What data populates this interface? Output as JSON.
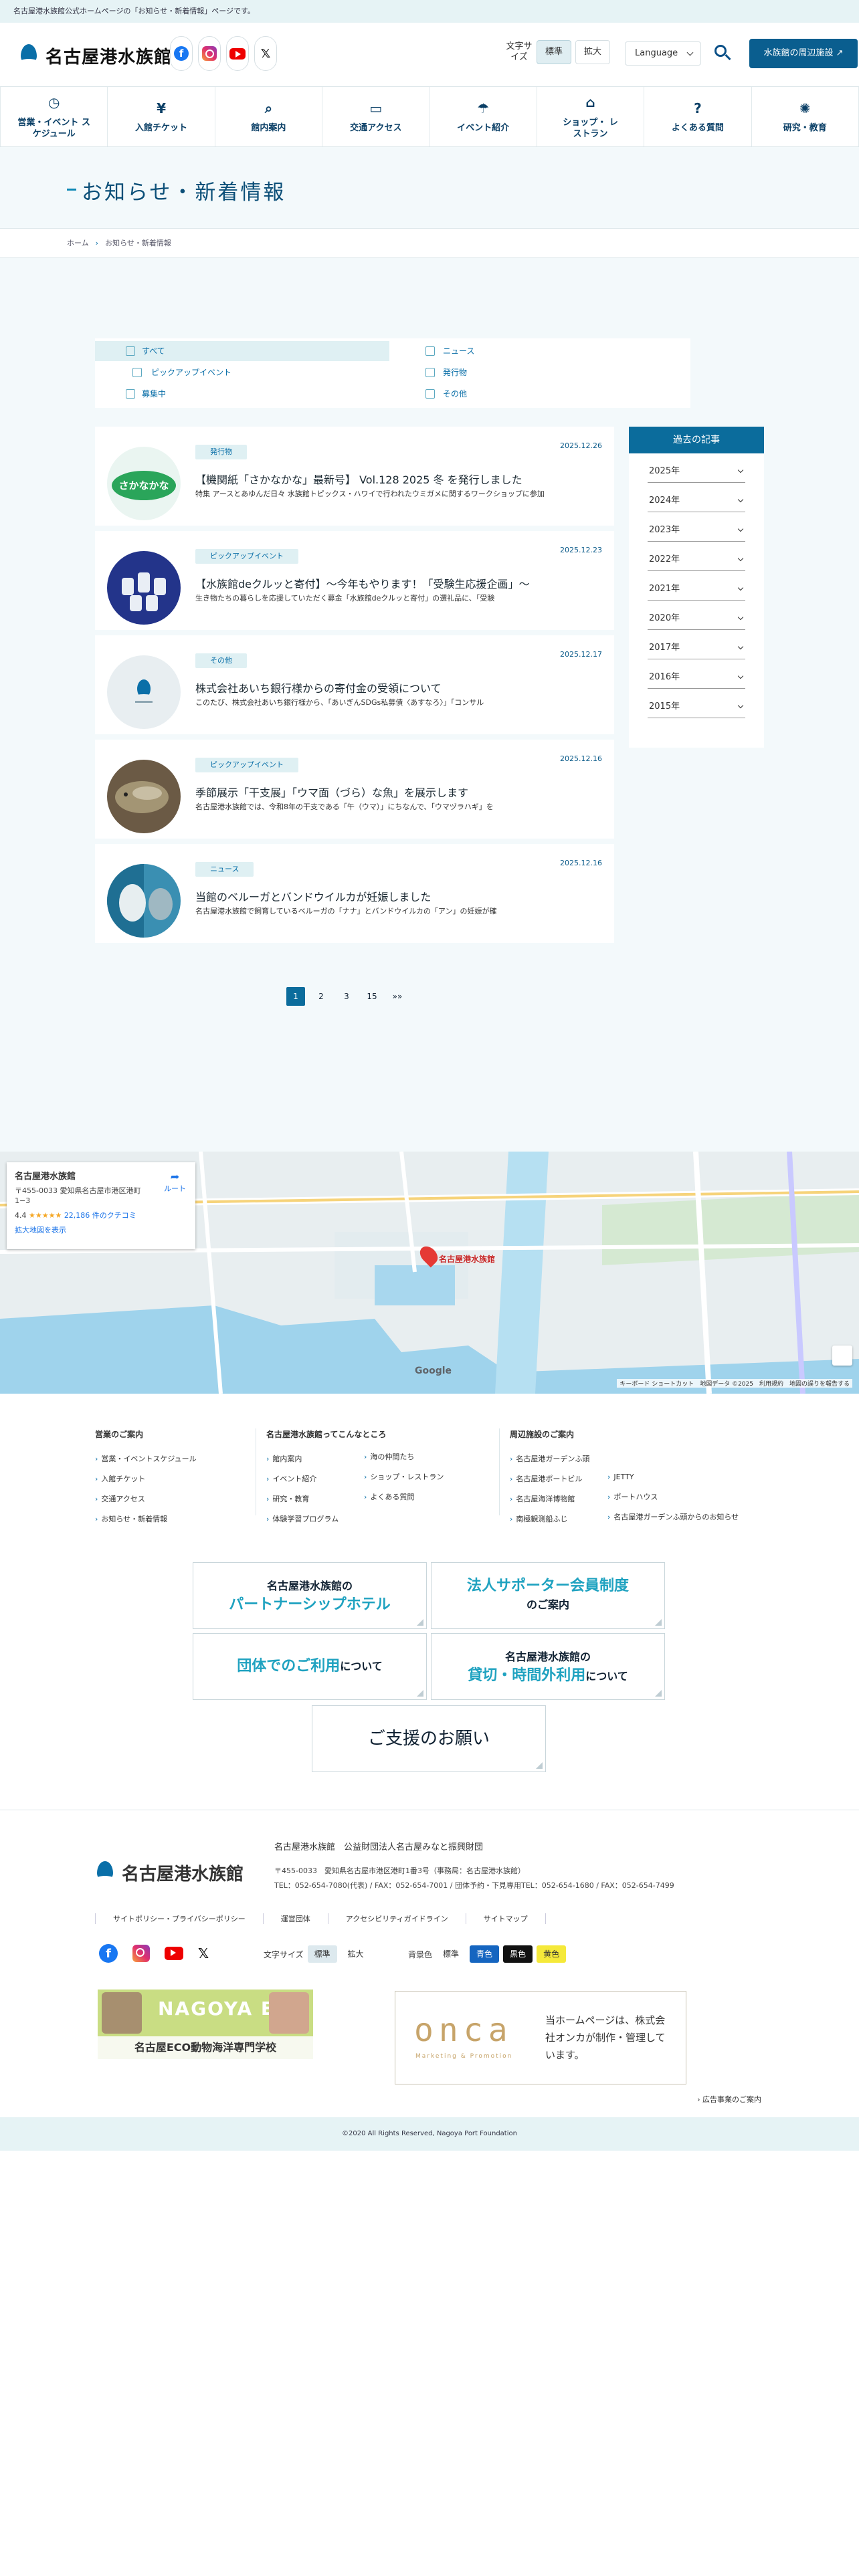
{
  "top_notice": "名古屋港水族館公式ホームページの「お知らせ・新着情報」ページです。",
  "header": {
    "logo_text": "名古屋港水族館",
    "font_size_label": "文字サイズ",
    "font_size_options": [
      "標準",
      "拡大"
    ],
    "language": "Language",
    "nearby_button": "水族館の周辺施設"
  },
  "gnav": [
    {
      "label": "営業・イベント スケジュール",
      "icon": "clock-icon"
    },
    {
      "label": "入館チケット",
      "icon": "yen-icon"
    },
    {
      "label": "館内案内",
      "icon": "map-search-icon"
    },
    {
      "label": "交通アクセス",
      "icon": "bus-icon"
    },
    {
      "label": "イベント紹介",
      "icon": "megaphone-icon"
    },
    {
      "label": "ショップ・ レストラン",
      "icon": "shop-icon"
    },
    {
      "label": "よくある質問",
      "icon": "question-icon"
    },
    {
      "label": "研究・教育",
      "icon": "bulb-icon"
    }
  ],
  "page_title": "お知らせ・新着情報",
  "breadcrumb": [
    "ホーム",
    "お知らせ・新着情報"
  ],
  "filters": [
    {
      "label": "すべて",
      "active": true
    },
    {
      "label": "ニュース",
      "active": false
    },
    {
      "label": "ピックアップイベント",
      "active": false
    },
    {
      "label": "発行物",
      "active": false
    },
    {
      "label": "募集中",
      "active": false
    },
    {
      "label": "その他",
      "active": false
    }
  ],
  "articles": [
    {
      "category": "発行物",
      "date": "2025.12.26",
      "title": "【機関紙「さかなかな」最新号】 Vol.128 2025 冬 を発行しました",
      "desc": "特集 アースとあゆんだ日々 水族館トピックス・ハワイで行われたウミガメに関するワークショップに参加"
    },
    {
      "category": "ピックアップイベント",
      "date": "2025.12.23",
      "title": "【水族館deクルッと寄付】～今年もやります！「受験生応援企画」～",
      "desc": "生き物たちの暮らしを応援していただく募金「水族館deクルッと寄付」の選礼品に、「受験"
    },
    {
      "category": "その他",
      "date": "2025.12.17",
      "title": "株式会社あいち銀行様からの寄付金の受領について",
      "desc": "このたび、株式会社あいち銀行様から、「あいぎんSDGs私募債〈あすなろ〉」「コンサル"
    },
    {
      "category": "ピックアップイベント",
      "date": "2025.12.16",
      "title": "季節展示「干支展」「ウマ面（づら）な魚」を展示します",
      "desc": "名古屋港水族館では、令和8年の干支である「午（ウマ）」にちなんで、「ウマヅラハギ」を"
    },
    {
      "category": "ニュース",
      "date": "2025.12.16",
      "title": "当館のベルーガとバンドウイルカが妊娠しました",
      "desc": "名古屋港水族館で飼育しているベルーガの「ナナ」とバンドウイルカの「アン」の妊娠が確"
    }
  ],
  "archive": {
    "heading": "過去の記事",
    "years": [
      "2025年",
      "2024年",
      "2023年",
      "2022年",
      "2021年",
      "2020年",
      "2017年",
      "2016年",
      "2015年"
    ]
  },
  "pager": [
    "1",
    "2",
    "3",
    "15",
    "»»"
  ],
  "map": {
    "place": "名古屋港水族館",
    "address": "〒455-0033 愛知県名古屋市港区港町 1−3",
    "rating": "4.4",
    "stars": "★★★★★",
    "reviews": "22,186 件のクチコミ",
    "route": "ルート",
    "enlarge": "拡大地図を表示",
    "pin_label": "名古屋港水族館",
    "attribution": "キーボード ショートカット　地図データ ©2025　利用規約　地図の誤りを報告する",
    "google": "Google"
  },
  "footer_nav": {
    "col1_title": "営業のご案内",
    "col1": [
      "営業・イベントスケジュール",
      "入館チケット",
      "交通アクセス",
      "お知らせ・新着情報"
    ],
    "col2_title": "名古屋港水族館ってこんなところ",
    "col2a": [
      "館内案内",
      "イベント紹介",
      "研究・教育",
      "体験学習プログラム"
    ],
    "col2b": [
      "海の仲間たち",
      "ショップ・レストラン",
      "よくある質問"
    ],
    "col3_title": "周辺施設のご案内",
    "col3a": [
      "名古屋港ガーデンふ頭",
      "名古屋港ポートビル",
      "名古屋海洋博物館",
      "南極観測船ふじ"
    ],
    "col3b": [
      "JETTY",
      "ポートハウス",
      "名古屋港ガーデンふ頭からのお知らせ"
    ]
  },
  "banners": {
    "b1_top": "名古屋港水族館の",
    "b1_key": "パートナーシップホテル",
    "b2_key": "法人サポーター会員制度",
    "b2_bottom": "のご案内",
    "b3_key": "団体でのご利用",
    "b3_rest": "について",
    "b4_top": "名古屋港水族館の",
    "b4_key": "貸切・時間外利用",
    "b4_rest": "について",
    "b5": "ご支援のお願い"
  },
  "foot": {
    "logo_text": "名古屋港水族館",
    "org": "名古屋港水族館　公益財団法人名古屋みなと振興財団",
    "address": "〒455-0033　愛知県名古屋市港区港町1番3号（事務局：名古屋港水族館）",
    "tel": "TEL：052-654-7080(代表) / FAX：052-654-7001 / 団体予約・下見専用TEL：052-654-1680 / FAX：052-654-7499",
    "links": [
      "サイトポリシー・プライバシーポリシー",
      "運営団体",
      "アクセシビリティガイドライン",
      "サイトマップ"
    ],
    "font_size_label": "文字サイズ",
    "font_size_options": [
      "標準",
      "拡大"
    ],
    "bg_label": "背景色",
    "bg_options": [
      "標準",
      "青色",
      "黒色",
      "黄色"
    ],
    "school_text": "名古屋ECO動物海洋専門学校",
    "school_logo": "NAGOYA ECO",
    "onca_logo": "onca",
    "onca_sub": "Marketing & Promotion",
    "onca_text": "当ホームページは、株式会社オンカが制作・管理しています。",
    "ad_link": "広告事業のご案内",
    "copyright": "©2020 All Rights Reserved, Nagoya Port Foundation"
  },
  "colors": {
    "brand": "#0b6c9c",
    "accent": "#1fa2c0",
    "tag_bg": "#dff0f3"
  }
}
